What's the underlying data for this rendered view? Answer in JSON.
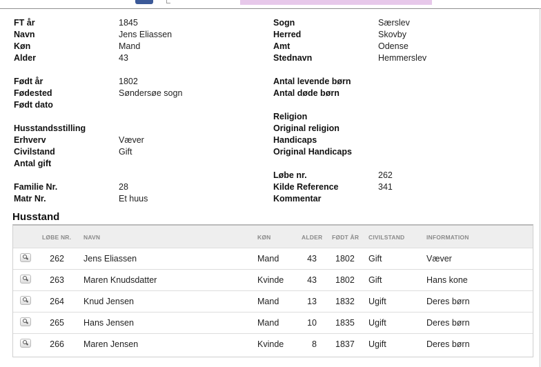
{
  "person": {
    "left": [
      {
        "label": "FT år",
        "value": "1845"
      },
      {
        "label": "Navn",
        "value": "Jens Eliassen"
      },
      {
        "label": "Køn",
        "value": "Mand"
      },
      {
        "label": "Alder",
        "value": "43"
      },
      {
        "label": "Født år",
        "value": "1802"
      },
      {
        "label": "Fødested",
        "value": "Søndersøe sogn"
      },
      {
        "label": "Født dato",
        "value": ""
      },
      {
        "label": "Husstandsstilling",
        "value": ""
      },
      {
        "label": "Erhverv",
        "value": "Væver"
      },
      {
        "label": "Civilstand",
        "value": "Gift"
      },
      {
        "label": "Antal gift",
        "value": ""
      },
      {
        "label": "Familie Nr.",
        "value": "28"
      },
      {
        "label": "Matr Nr.",
        "value": "Et huus"
      }
    ],
    "right": [
      {
        "label": "Sogn",
        "value": "Særslev"
      },
      {
        "label": "Herred",
        "value": "Skovby"
      },
      {
        "label": "Amt",
        "value": "Odense"
      },
      {
        "label": "Stednavn",
        "value": "Hemmerslev"
      },
      {
        "label": "Antal levende børn",
        "value": ""
      },
      {
        "label": "Antal døde børn",
        "value": ""
      },
      {
        "label": "Religion",
        "value": ""
      },
      {
        "label": "Original religion",
        "value": ""
      },
      {
        "label": "Handicaps",
        "value": ""
      },
      {
        "label": "Original Handicaps",
        "value": ""
      },
      {
        "label": "Løbe nr.",
        "value": "262"
      },
      {
        "label": "Kilde Reference",
        "value": "341"
      },
      {
        "label": "Kommentar",
        "value": ""
      }
    ]
  },
  "household": {
    "title": "Husstand",
    "columns": [
      "LØBE NR.",
      "NAVN",
      "KØN",
      "ALDER",
      "FØDT ÅR",
      "CIVILSTAND",
      "INFORMATION"
    ],
    "rows": [
      {
        "lobe": "262",
        "navn": "Jens Eliassen",
        "kon": "Mand",
        "alder": "43",
        "fodt": "1802",
        "civil": "Gift",
        "info": "Væver"
      },
      {
        "lobe": "263",
        "navn": "Maren Knudsdatter",
        "kon": "Kvinde",
        "alder": "43",
        "fodt": "1802",
        "civil": "Gift",
        "info": "Hans kone"
      },
      {
        "lobe": "264",
        "navn": "Knud Jensen",
        "kon": "Mand",
        "alder": "13",
        "fodt": "1832",
        "civil": "Ugift",
        "info": "Deres børn"
      },
      {
        "lobe": "265",
        "navn": "Hans Jensen",
        "kon": "Mand",
        "alder": "10",
        "fodt": "1835",
        "civil": "Ugift",
        "info": "Deres børn"
      },
      {
        "lobe": "266",
        "navn": "Maren Jensen",
        "kon": "Kvinde",
        "alder": "8",
        "fodt": "1837",
        "civil": "Ugift",
        "info": "Deres børn"
      }
    ]
  },
  "icons": {
    "row_action": "magnifier-icon"
  },
  "colors": {
    "header_bg": "#eeeeee",
    "header_text": "#8a8a8a",
    "border": "#cfcfcf"
  }
}
